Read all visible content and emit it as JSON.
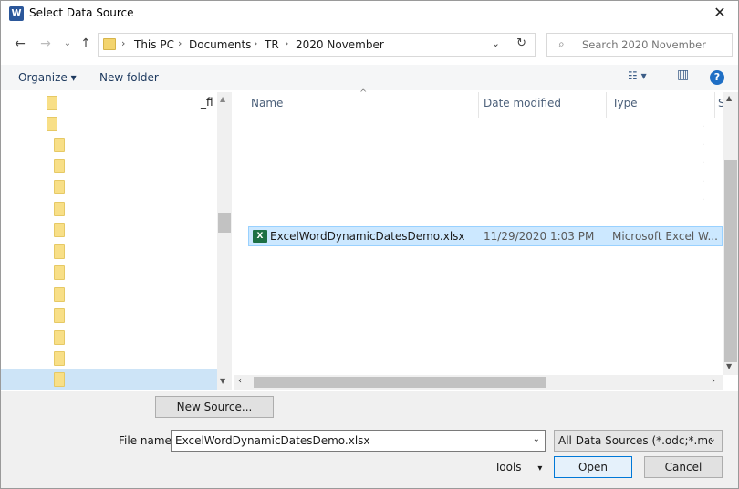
{
  "window": {
    "title": "Select Data Source",
    "app_icon_letter": "W",
    "close_glyph": "✕"
  },
  "address_bar": {
    "crumbs": [
      "This PC",
      "Documents",
      "TR",
      "2020 November"
    ],
    "separator": "›",
    "refresh_glyph": "↻",
    "dropdown_glyph": "⌄"
  },
  "search": {
    "placeholder": "Search 2020 November",
    "icon_glyph": "⌕"
  },
  "nav_glyphs": {
    "back": "←",
    "forward": "→",
    "recent": "⌄",
    "up": "↑"
  },
  "toolbar": {
    "organize_label": "Organize ▾",
    "new_folder_label": "New folder",
    "view_glyph": "☷ ▾",
    "pane_glyph": "▥",
    "help_glyph": "?"
  },
  "nav_pane": {
    "fragment_text": "_fi"
  },
  "columns": {
    "name": "Name",
    "date_modified": "Date modified",
    "type": "Type",
    "size_fragment": "S"
  },
  "files": [
    {
      "name": "ExcelWordDynamicDatesDemo.xlsx",
      "date_modified": "11/29/2020 1:03 PM",
      "type": "Microsoft Excel W...",
      "icon": "excel-icon",
      "selected": true
    }
  ],
  "bottom": {
    "new_source_label": "New Source...",
    "file_name_label": "File name:",
    "file_name_value": "ExcelWordDynamicDatesDemo.xlsx",
    "filter_value": "All Data Sources (*.odc;*.mdb;*",
    "tools_label": "Tools",
    "tools_caret": "▾",
    "open_label": "Open",
    "cancel_label": "Cancel"
  },
  "colors": {
    "selection": "#cce8ff",
    "excel_green": "#1d7044",
    "folder_yellow": "#f8df87"
  }
}
